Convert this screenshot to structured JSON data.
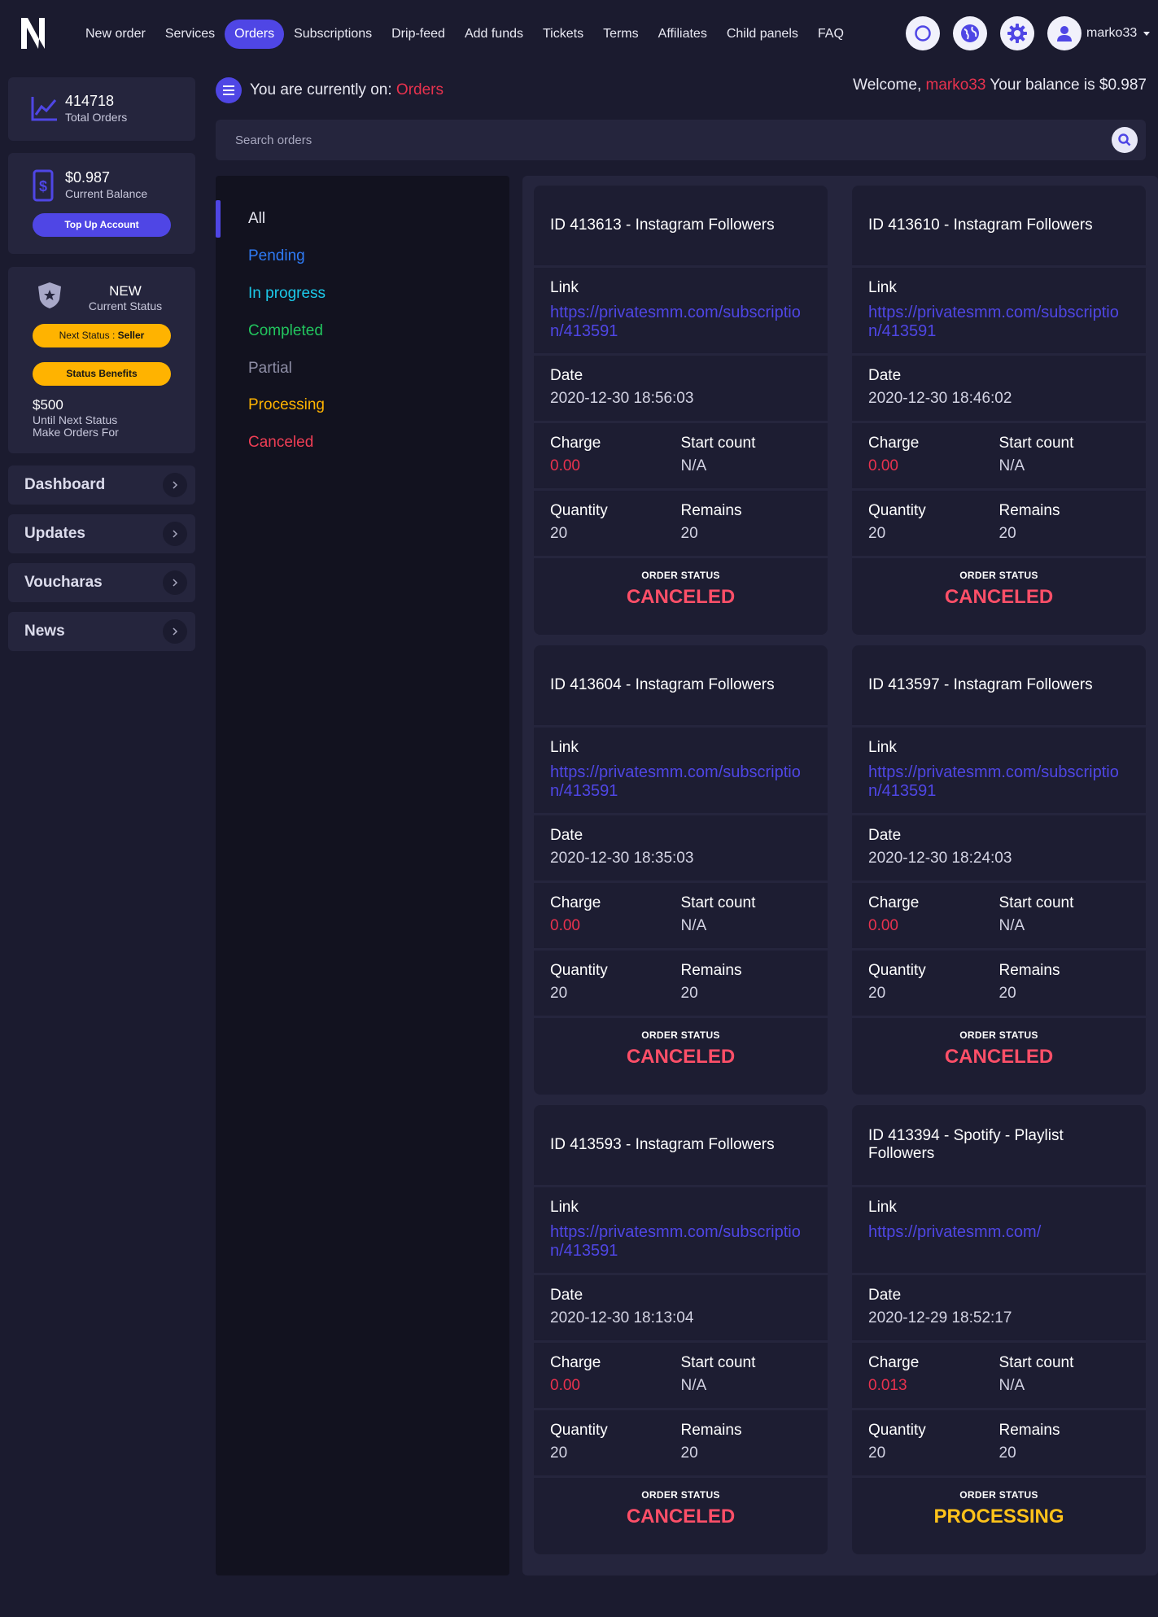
{
  "nav": {
    "items": [
      {
        "label": "New order",
        "active": false
      },
      {
        "label": "Services",
        "active": false
      },
      {
        "label": "Orders",
        "active": true
      },
      {
        "label": "Subscriptions",
        "active": false
      },
      {
        "label": "Drip-feed",
        "active": false
      },
      {
        "label": "Add funds",
        "active": false
      },
      {
        "label": "Tickets",
        "active": false
      },
      {
        "label": "Terms",
        "active": false
      },
      {
        "label": "Affiliates",
        "active": false
      },
      {
        "label": "Child panels",
        "active": false
      },
      {
        "label": "FAQ",
        "active": false
      }
    ],
    "username": "marko33"
  },
  "sidebar": {
    "orders": {
      "value": "414718",
      "label": "Total Orders"
    },
    "balance": {
      "value": "$0.987",
      "label": "Current Balance",
      "button": "Top Up Account"
    },
    "status": {
      "current": "NEW",
      "current_label": "Current Status",
      "next_prefix": "Next Status : ",
      "next_value": "Seller",
      "benefits": "Status Benefits",
      "amount": "$500",
      "line1": "Until Next Status",
      "line2": "Make Orders For"
    },
    "links": [
      "Dashboard",
      "Updates",
      "Voucharas",
      "News"
    ]
  },
  "header": {
    "crumb_prefix": "You are currently on:",
    "crumb_active": "Orders",
    "welcome_prefix": "Welcome,",
    "welcome_user": "marko33",
    "welcome_balance": "Your balance is $0.987"
  },
  "search": {
    "placeholder": "Search orders",
    "value": ""
  },
  "filters": [
    {
      "label": "All",
      "color": "#e6e6f0"
    },
    {
      "label": "Pending",
      "color": "#2f7bf5"
    },
    {
      "label": "In progress",
      "color": "#1cc8e8"
    },
    {
      "label": "Completed",
      "color": "#22c55e"
    },
    {
      "label": "Partial",
      "color": "#8e8ea6"
    },
    {
      "label": "Processing",
      "color": "#ffb300"
    },
    {
      "label": "Canceled",
      "color": "#ef3e55"
    }
  ],
  "labels": {
    "link": "Link",
    "date": "Date",
    "charge": "Charge",
    "start_count": "Start count",
    "quantity": "Quantity",
    "remains": "Remains",
    "order_status": "ORDER STATUS"
  },
  "orders": [
    {
      "title": "ID 413613 - Instagram Followers",
      "link": "https://privatesmm.com/subscription/413591",
      "date": "2020-12-30 18:56:03",
      "charge": "0.00",
      "start_count": "N/A",
      "quantity": "20",
      "remains": "20",
      "status": "CANCELED"
    },
    {
      "title": "ID 413610 - Instagram Followers",
      "link": "https://privatesmm.com/subscription/413591",
      "date": "2020-12-30 18:46:02",
      "charge": "0.00",
      "start_count": "N/A",
      "quantity": "20",
      "remains": "20",
      "status": "CANCELED"
    },
    {
      "title": "ID 413604 - Instagram Followers",
      "link": "https://privatesmm.com/subscription/413591",
      "date": "2020-12-30 18:35:03",
      "charge": "0.00",
      "start_count": "N/A",
      "quantity": "20",
      "remains": "20",
      "status": "CANCELED"
    },
    {
      "title": "ID 413597 - Instagram Followers",
      "link": "https://privatesmm.com/subscription/413591",
      "date": "2020-12-30 18:24:03",
      "charge": "0.00",
      "start_count": "N/A",
      "quantity": "20",
      "remains": "20",
      "status": "CANCELED"
    },
    {
      "title": "ID 413593 - Instagram Followers",
      "link": "https://privatesmm.com/subscription/413591",
      "date": "2020-12-30 18:13:04",
      "charge": "0.00",
      "start_count": "N/A",
      "quantity": "20",
      "remains": "20",
      "status": "CANCELED"
    },
    {
      "title": "ID 413394 - Spotify - Playlist Followers",
      "link": "https://privatesmm.com/",
      "date": "2020-12-29 18:52:17",
      "charge": "0.013",
      "start_count": "N/A",
      "quantity": "20",
      "remains": "20",
      "status": "PROCESSING"
    }
  ]
}
